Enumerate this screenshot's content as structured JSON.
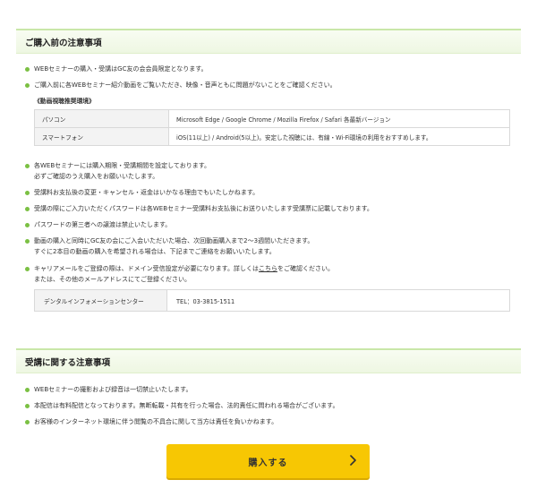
{
  "pre_purchase": {
    "heading": "ご購入前の注意事項",
    "bullets": [
      "WEBセミナーの購入・受講はGC友の会会員限定となります。",
      "ご購入前に各WEBセミナー紹介動画をご覧いただき、映像・音声ともに問題がないことをご確認ください。"
    ],
    "env_heading": "《動画視聴推奨環境》",
    "env_table": [
      {
        "label": "パソコン",
        "value": "Microsoft Edge / Google Chrome / Mozilla Firefox / Safari 各最新バージョン"
      },
      {
        "label": "スマートフォン",
        "value": "iOS(11以上) / Android(5以上)。安定した視聴には、有線・Wi-Fi環境の利用をおすすめします。"
      }
    ],
    "bullets2": [
      {
        "line1": "各WEBセミナーには購入期限・受講期間を設定しております。",
        "line2": "必ずご確認のうえ購入をお願いいたします。"
      },
      {
        "line1": "受講料お支払後の変更・キャンセル・返金はいかなる理由でもいたしかねます。",
        "line2": ""
      },
      {
        "line1": "受講の際にご入力いただくパスワードは各WEBセミナー受講料お支払後にお送りいたします受講票に記載しております。",
        "line2": ""
      },
      {
        "line1": "パスワードの第三者への譲渡は禁止いたします。",
        "line2": ""
      },
      {
        "line1": "動画の購入と同時にGC友の会にご入会いただいた場合、次回動画購入まで2〜3週間いただきます。",
        "line2": "すぐに2本目の動画の購入を希望される場合は、下記までご連絡をお願いいたします。"
      }
    ],
    "career_line1_pre": "キャリアメールをご登録の際は、ドメイン受信設定が必要になります。詳しくは",
    "career_link": "こちら",
    "career_line1_post": "をご確認ください。",
    "career_line2": "または、その他のメールアドレスにてご登録ください。",
    "contact": {
      "label": "デンタルインフォメーションセンター",
      "value": "TEL：03-3815-1511"
    }
  },
  "attendance": {
    "heading": "受講に関する注意事項",
    "bullets": [
      "WEBセミナーの撮影および録音は一切禁止いたします。",
      "本配信は有料配信となっております。無断転載・共有を行った場合、法的責任に問われる場合がございます。",
      "お客様のインターネット環境に伴う閲覧の不具合に関して当方は責任を負いかねます。"
    ]
  },
  "buy_button": {
    "label": "購入する",
    "icon": "chevron-right-icon"
  },
  "colors": {
    "accent": "#7bc043",
    "button": "#f7c703",
    "heading_border": "#c9e7a8"
  }
}
